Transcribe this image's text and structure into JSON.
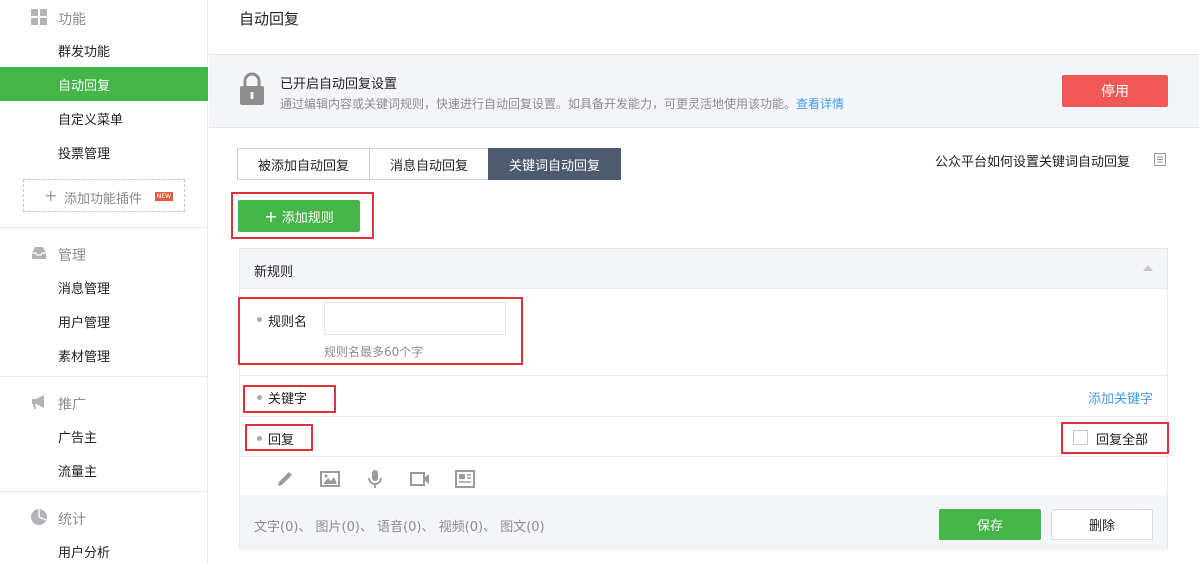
{
  "sidebar": {
    "sections": [
      {
        "title": "功能",
        "icon": "grid-icon",
        "items": [
          "群发功能",
          "自动回复",
          "自定义菜单",
          "投票管理"
        ]
      },
      {
        "title": "管理",
        "icon": "inbox-icon",
        "items": [
          "消息管理",
          "用户管理",
          "素材管理"
        ]
      },
      {
        "title": "推广",
        "icon": "megaphone-icon",
        "items": [
          "广告主",
          "流量主"
        ]
      },
      {
        "title": "统计",
        "icon": "pie-chart-icon",
        "items": [
          "用户分析"
        ]
      }
    ],
    "active_item": "自动回复",
    "add_plugin_label": "添加功能插件",
    "new_badge": "NEW"
  },
  "page": {
    "title": "自动回复"
  },
  "status": {
    "title": "已开启自动回复设置",
    "desc": "通过编辑内容或关键词规则，快速进行自动回复设置。如具备开发能力，可更灵活地使用该功能。",
    "link": "查看详情",
    "stop_label": "停用"
  },
  "tabs": [
    "被添加自动回复",
    "消息自动回复",
    "关键词自动回复"
  ],
  "active_tab": "关键词自动回复",
  "help_link": "公众平台如何设置关键词自动回复",
  "add_rule_label": "添加规则",
  "rule": {
    "header": "新规则",
    "name_label": "规则名",
    "name_value": "",
    "name_hint": "规则名最多60个字",
    "keyword_label": "关键字",
    "add_keyword": "添加关键字",
    "reply_label": "回复",
    "reply_all_label": "回复全部",
    "counts": "文字(0)、 图片(0)、 语音(0)、 视频(0)、 图文(0)",
    "save_label": "保存",
    "delete_label": "删除"
  },
  "colors": {
    "accent_green": "#44b549",
    "danger_red": "#f15757",
    "link_blue": "#459ae9",
    "annotation_red": "#e0313a"
  }
}
